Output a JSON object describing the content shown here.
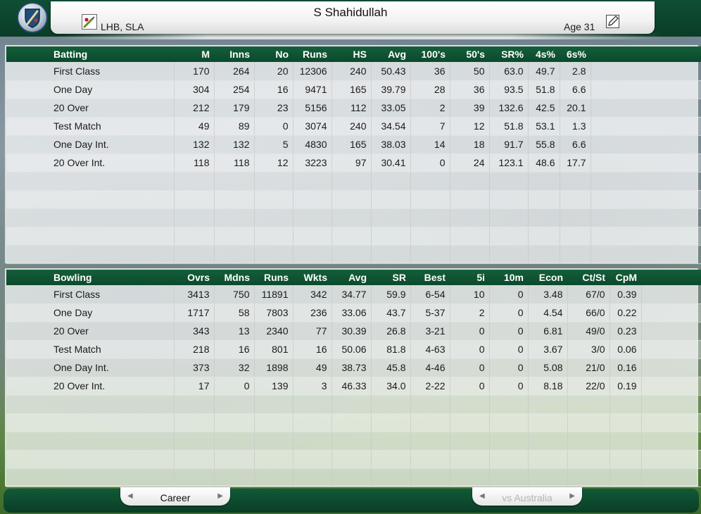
{
  "header": {
    "player_name": "S Shahidullah",
    "player_style": "LHB, SLA",
    "age_label": "Age 31",
    "icons": {
      "logo": "team-shield-icon",
      "style": "bat-ball-icon",
      "edit": "pencil-icon"
    }
  },
  "batting": {
    "columns": [
      "Batting",
      "M",
      "Inns",
      "No",
      "Runs",
      "HS",
      "Avg",
      "100's",
      "50's",
      "SR%",
      "4s%",
      "6s%"
    ],
    "rows": [
      [
        "First Class",
        "170",
        "264",
        "20",
        "12306",
        "240",
        "50.43",
        "36",
        "50",
        "63.0",
        "49.7",
        "2.8"
      ],
      [
        "One Day",
        "304",
        "254",
        "16",
        "9471",
        "165",
        "39.79",
        "28",
        "36",
        "93.5",
        "51.8",
        "6.6"
      ],
      [
        "20 Over",
        "212",
        "179",
        "23",
        "5156",
        "112",
        "33.05",
        "2",
        "39",
        "132.6",
        "42.5",
        "20.1"
      ],
      [
        "Test Match",
        "49",
        "89",
        "0",
        "3074",
        "240",
        "34.54",
        "7",
        "12",
        "51.8",
        "53.1",
        "1.3"
      ],
      [
        "One Day Int.",
        "132",
        "132",
        "5",
        "4830",
        "165",
        "38.03",
        "14",
        "18",
        "91.7",
        "55.8",
        "6.6"
      ],
      [
        "20 Over Int.",
        "118",
        "118",
        "12",
        "3223",
        "97",
        "30.41",
        "0",
        "24",
        "123.1",
        "48.6",
        "17.7"
      ]
    ]
  },
  "bowling": {
    "columns": [
      "Bowling",
      "Ovrs",
      "Mdns",
      "Runs",
      "Wkts",
      "Avg",
      "SR",
      "Best",
      "5i",
      "10m",
      "Econ",
      "Ct/St",
      "CpM"
    ],
    "rows": [
      [
        "First Class",
        "3413",
        "750",
        "11891",
        "342",
        "34.77",
        "59.9",
        "6-54",
        "10",
        "0",
        "3.48",
        "67/0",
        "0.39"
      ],
      [
        "One Day",
        "1717",
        "58",
        "7803",
        "236",
        "33.06",
        "43.7",
        "5-37",
        "2",
        "0",
        "4.54",
        "66/0",
        "0.22"
      ],
      [
        "20 Over",
        "343",
        "13",
        "2340",
        "77",
        "30.39",
        "26.8",
        "3-21",
        "0",
        "0",
        "6.81",
        "49/0",
        "0.23"
      ],
      [
        "Test Match",
        "218",
        "16",
        "801",
        "16",
        "50.06",
        "81.8",
        "4-63",
        "0",
        "0",
        "3.67",
        "3/0",
        "0.06"
      ],
      [
        "One Day Int.",
        "373",
        "32",
        "1898",
        "49",
        "38.73",
        "45.8",
        "4-46",
        "0",
        "0",
        "5.08",
        "21/0",
        "0.16"
      ],
      [
        "20 Over Int.",
        "17",
        "0",
        "139",
        "3",
        "46.33",
        "34.0",
        "2-22",
        "0",
        "0",
        "8.18",
        "22/0",
        "0.19"
      ]
    ]
  },
  "footer": {
    "career_tab": {
      "label": "Career",
      "prev_icon": "left-arrow-icon",
      "next_icon": "right-arrow-icon"
    },
    "versus_tab": {
      "label": "vs Australia",
      "prev_icon": "left-arrow-icon",
      "next_icon": "right-arrow-icon"
    }
  },
  "colors": {
    "header_green": "#0f4f34",
    "table_header_green": "#155e3b",
    "disabled_text": "#b5b5b5"
  }
}
